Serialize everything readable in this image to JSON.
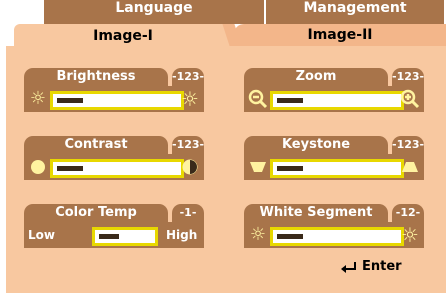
{
  "tabs": {
    "back": [
      "Language",
      "Management"
    ],
    "front": [
      "Image-I",
      "Image-II"
    ]
  },
  "controls": {
    "brightness": {
      "label": "Brightness",
      "value": "-123-"
    },
    "zoom": {
      "label": "Zoom",
      "value": "-123-"
    },
    "contrast": {
      "label": "Contrast",
      "value": "-123-"
    },
    "keystone": {
      "label": "Keystone",
      "value": "-123-"
    },
    "colortemp": {
      "label": "Color Temp",
      "value": "-1-",
      "low": "Low",
      "high": "High"
    },
    "whitesegment": {
      "label": "White Segment",
      "value": "-12-"
    }
  },
  "enter_label": "Enter",
  "colors": {
    "panel": "#f8c8a0",
    "bar": "#a8744a",
    "track_border": "#e8d800"
  }
}
